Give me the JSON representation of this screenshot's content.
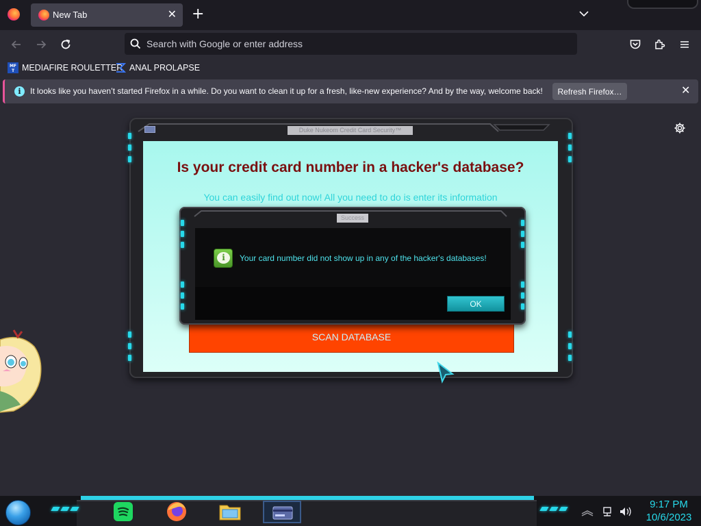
{
  "browser": {
    "tab_title": "New Tab",
    "url_placeholder": "Search with Google or enter address",
    "bookmarks": [
      {
        "label": "MEDIAFIRE ROULETTER",
        "icon": "mediafire-icon"
      },
      {
        "label": "ANAL PROLAPSE",
        "icon": "sigma-icon"
      }
    ],
    "notification": {
      "message": "It looks like you haven’t started Firefox in a while. Do you want to clean it up for a fresh, like-new experience? And by the way, welcome back!",
      "button": "Refresh Firefox…"
    }
  },
  "scam_window": {
    "title": "Duke Nukeom Credit Card Security™",
    "heading": "Is your credit card number in a hacker's database?",
    "subheading": "You can easily find out now! All you need to do is enter its information",
    "scan_button": "SCAN DATABASE"
  },
  "dialog": {
    "title": "Success",
    "message": "Your card number did not show up in any of the hacker's databases!",
    "ok_button": "OK"
  },
  "taskbar": {
    "apps": [
      "spotify-icon",
      "firefox-icon",
      "file-explorer-icon",
      "scam-app-icon"
    ],
    "time": "9:17 PM",
    "date": "10/6/2023"
  },
  "colors": {
    "led": "#27d9ea",
    "scan_button": "#ff4400",
    "heading": "#7a1010",
    "accent_text": "#2fd4d9"
  }
}
